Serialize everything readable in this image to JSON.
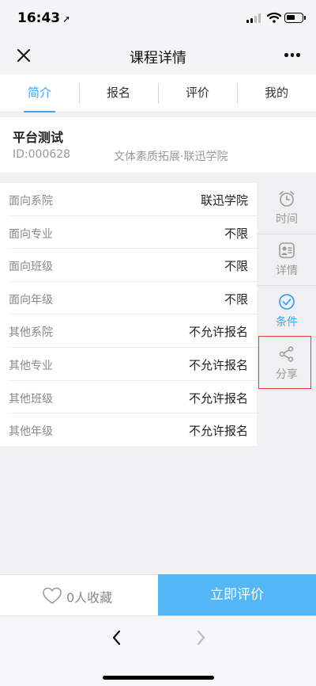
{
  "status_bar": {
    "time": "16:43",
    "location_arrow": "➚"
  },
  "navbar": {
    "title": "课程详情",
    "close_icon": "close-icon",
    "more_icon": "more-icon"
  },
  "tabs": [
    {
      "label": "简介",
      "active": true
    },
    {
      "label": "报名",
      "active": false
    },
    {
      "label": "评价",
      "active": false
    },
    {
      "label": "我的",
      "active": false
    }
  ],
  "course": {
    "name": "平台测试",
    "id": "ID:000628",
    "category": "文体素质拓展·联迅学院"
  },
  "details": [
    {
      "label": "面向系院",
      "value": "联迅学院"
    },
    {
      "label": "面向专业",
      "value": "不限"
    },
    {
      "label": "面向班级",
      "value": "不限"
    },
    {
      "label": "面向年级",
      "value": "不限"
    },
    {
      "label": "其他系院",
      "value": "不允许报名"
    },
    {
      "label": "其他专业",
      "value": "不允许报名"
    },
    {
      "label": "其他班级",
      "value": "不允许报名"
    },
    {
      "label": "其他年级",
      "value": "不允许报名"
    }
  ],
  "side_menu": [
    {
      "label": "时间",
      "icon": "alarm-clock-icon",
      "active": false
    },
    {
      "label": "详情",
      "icon": "profile-card-icon",
      "active": false
    },
    {
      "label": "条件",
      "icon": "check-circle-icon",
      "active": true
    },
    {
      "label": "分享",
      "icon": "share-icon",
      "active": false
    }
  ],
  "bottom_bar": {
    "favorite_label": "0人收藏",
    "rate_button": "立即评价"
  },
  "colors": {
    "accent": "#3da3f5",
    "button": "#54b7f5",
    "highlight": "#e0403a"
  }
}
